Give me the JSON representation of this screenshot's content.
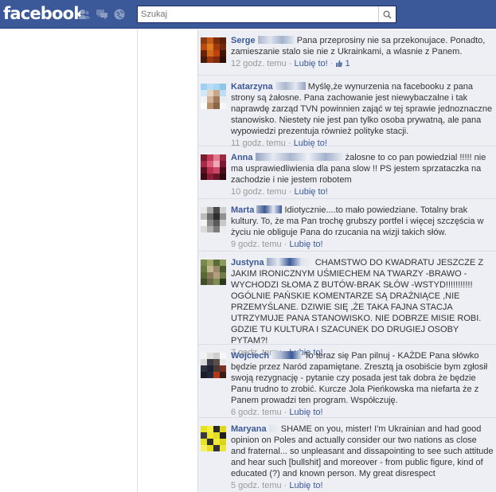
{
  "brand": {
    "logo_text": "facebook",
    "color": "#3b5998"
  },
  "header": {
    "search_placeholder": "Szukaj",
    "icons": [
      "friend-requests-icon",
      "messages-icon",
      "notifications-icon",
      "search-icon"
    ]
  },
  "comments": [
    {
      "author": "Serge",
      "text": "Pana przeprosiny nie sa przekonujace. Ponadto, zamieszanie stalo sie nie z Ukrainkami, a wlasnie z Panem.",
      "time": "12 godz. temu",
      "like": "Lubię to!",
      "likes": "1"
    },
    {
      "author": "Katarzyna",
      "text": "Myślę,że wynurzenia na facebooku z pana strony są żałosne. Pana zachowanie jest niewybaczalne i tak naprawdę zarząd TVN powinnien zająć w tej sprawie jednoznaczne stanowisko. Niestety nie jest pan tylko osoba prywatną, ale pana wypowiedzi prezentuja również polityke stacji.",
      "time": "11 godz. temu",
      "like": "Lubię to!"
    },
    {
      "author": "Anna",
      "text": "żalosne to co pan powiedzial !!!!! nie ma usprawiedliwienia dla pana slow !! PS jestem sprzataczka na zachodzie i nie jestem robotem",
      "time": "10 godz. temu",
      "like": "Lubię to!"
    },
    {
      "author": "Marta",
      "text": "Idiotycznie....to mało powiedziane. Totalny brak kultury. To, że ma Pan trochę grubszy portfel i więcej szczęścia w życiu nie obliguje Pana do rzucania na wizji takich słów.",
      "time": "9 godz. temu",
      "like": "Lubię to!"
    },
    {
      "author": "Justyna",
      "text": "CHAMSTWO DO KWADRATU JESZCZE Z JAKIM IRONICZNYM UŚMIECHEM NA TWARZY -BRAWO -WYCHODZI SŁOMA Z BUTÓW-BRAK SŁÓW -WSTYD!!!!!!!!!!! OGÓLNIE PAŃSKIE KOMENTARZE SĄ DRAŻNIĄCE ,NIE PRZEMYŚLANE. DZIWIE SIĘ ,ŻE TAKA FAJNA STACJA UTRZYMUJE PANA STANOWISKO. NIE DOBRZE MISIE ROBI. GDZIE TU KULTURA I SZACUNEK DO DRUGIEJ OSOBY PYTAM?!",
      "time": "7 godz. temu",
      "like": "Lubię to!"
    },
    {
      "author": "Wojciech",
      "text": "To teraz się Pan pilnuj - KAŻDE Pana słówko będzie przez Naród zapamiętane. Zresztą ja osobiście bym zgłosił swoją rezygnację - pytanie czy posada jest tak dobra że będzie Panu trudno to zrobić. Kurcze Jola Pieńkowska ma niefarta że z Panem prowadzi ten program. Współczuję.",
      "time": "6 godz. temu",
      "like": "Lubię to!"
    },
    {
      "author": "Maryana",
      "text": "SHAME on you, mister! I'm Ukrainian and had good opinion on Poles and actually consider our two nations as close and fraternal... so unpleasant and dissapointing to see such attitude and hear such [bullshit] and moreover - from public figure, kind of educated (?) and known person. My great disrespect",
      "time": "5 godz. temu",
      "like": "Lubię to!"
    }
  ]
}
